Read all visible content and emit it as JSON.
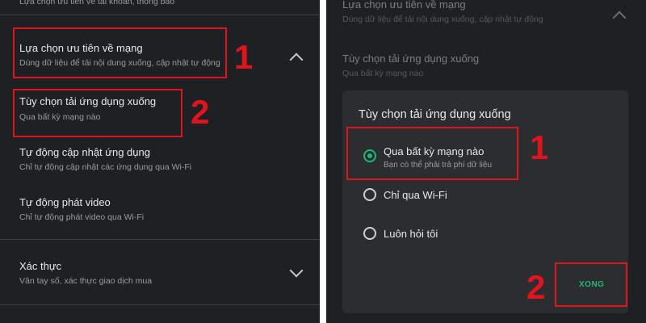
{
  "left": {
    "items": [
      {
        "title": "",
        "subtitle": "Lựa chọn ưu tiên về tài khoản, thông báo"
      },
      {
        "title": "Lựa chọn ưu tiên về mạng",
        "subtitle": "Dùng dữ liệu để tải nội dung xuống, cập nhật tự động"
      },
      {
        "title": "Tùy chọn tải ứng dụng xuống",
        "subtitle": "Qua bất kỳ mạng nào"
      },
      {
        "title": "Tự động cập nhật ứng dụng",
        "subtitle": "Chỉ tự động cập nhật các ứng dụng qua Wi-Fi"
      },
      {
        "title": "Tự động phát video",
        "subtitle": "Chỉ tự động phát video qua Wi-Fi"
      },
      {
        "title": "Xác thực",
        "subtitle": "Vân tay số, xác thực giao dịch mua"
      }
    ],
    "markers": [
      "1",
      "2"
    ]
  },
  "right": {
    "background_items": [
      {
        "title": "Lựa chọn ưu tiên về mạng",
        "subtitle": "Dùng dữ liệu để tải nội dung xuống, cập nhật tự động"
      },
      {
        "title": "Tùy chọn tải ứng dụng xuống",
        "subtitle": "Qua bất kỳ mạng nào"
      }
    ],
    "dialog": {
      "title": "Tùy chọn tải ứng dụng xuống",
      "options": [
        {
          "label": "Qua bất kỳ mạng nào",
          "sub": "Bạn có thể phải trả phí dữ liệu",
          "checked": true
        },
        {
          "label": "Chỉ qua Wi-Fi",
          "sub": "",
          "checked": false
        },
        {
          "label": "Luôn hỏi tôi",
          "sub": "",
          "checked": false
        }
      ],
      "done_label": "XONG"
    },
    "markers": [
      "1",
      "2"
    ]
  },
  "colors": {
    "background": "#1f2024",
    "accent": "#1fb874",
    "annotation": "#e0141c"
  }
}
